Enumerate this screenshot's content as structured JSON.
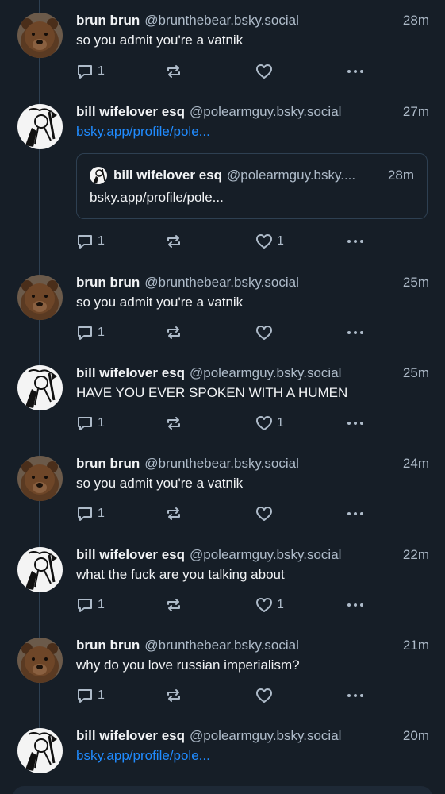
{
  "users": {
    "brun": {
      "display_name": "brun brun",
      "handle": "@brunthebear.bsky.social",
      "avatar_icon": "bear-avatar"
    },
    "bill": {
      "display_name": "bill wifelover esq",
      "handle": "@polearmguy.bsky.social",
      "avatar_icon": "sketch-avatar"
    }
  },
  "colors": {
    "background": "#161e27",
    "link": "#208bfe",
    "muted": "#aebbc9",
    "thread_line": "#2e4052"
  },
  "posts": [
    {
      "author": "brun brun",
      "handle": "@brunthebear.bsky.social",
      "time": "28m",
      "text": "so you admit you're a vatnik",
      "reply_count": "1",
      "like_count": ""
    },
    {
      "author": "bill wifelover esq",
      "handle": "@polearmguy.bsky.social",
      "time": "27m",
      "text": "bsky.app/profile/pole...",
      "reply_count": "1",
      "like_count": "1",
      "quote": {
        "author": "bill wifelover esq",
        "handle": "@polearmguy.bsky....",
        "time": "28m",
        "text": "bsky.app/profile/pole..."
      }
    },
    {
      "author": "brun brun",
      "handle": "@brunthebear.bsky.social",
      "time": "25m",
      "text": "so you admit you're a vatnik",
      "reply_count": "1",
      "like_count": ""
    },
    {
      "author": "bill wifelover esq",
      "handle": "@polearmguy.bsky.social",
      "time": "25m",
      "text": "HAVE YOU EVER SPOKEN WITH A HUMEN",
      "reply_count": "1",
      "like_count": "1"
    },
    {
      "author": "brun brun",
      "handle": "@brunthebear.bsky.social",
      "time": "24m",
      "text": "so you admit you're a vatnik",
      "reply_count": "1",
      "like_count": ""
    },
    {
      "author": "bill wifelover esq",
      "handle": "@polearmguy.bsky.social",
      "time": "22m",
      "text": "what the fuck are you talking about",
      "reply_count": "1",
      "like_count": "1"
    },
    {
      "author": "brun brun",
      "handle": "@brunthebear.bsky.social",
      "time": "21m",
      "text": "why do you love russian imperialism?",
      "reply_count": "1",
      "like_count": ""
    },
    {
      "author": "bill wifelover esq",
      "handle": "@polearmguy.bsky.social",
      "time": "20m",
      "text": "bsky.app/profile/pole..."
    }
  ]
}
